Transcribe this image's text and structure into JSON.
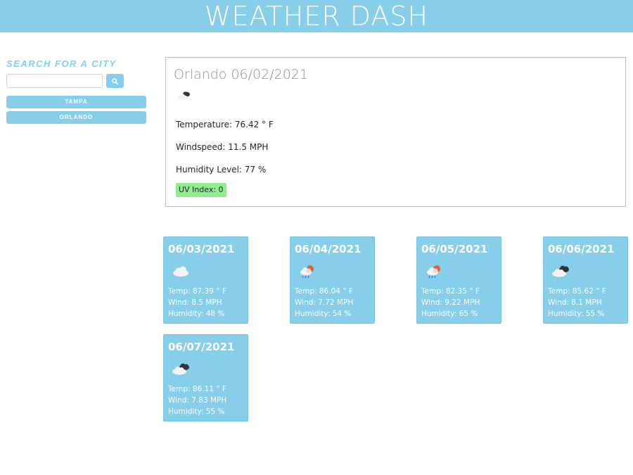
{
  "app": {
    "title": "WEATHER DASH"
  },
  "search": {
    "title": "SEARCH FOR A CITY",
    "input_value": "",
    "button_icon": "search-icon"
  },
  "history": [
    "TAMPA",
    "ORLANDO"
  ],
  "current": {
    "heading": "Orlando 06/02/2021",
    "icon": "cloudy-icon",
    "temperature": "Temperature: 76.42 ° F",
    "wind": "Windspeed: 11.5 MPH",
    "humidity": "Humidity Level: 77 %",
    "uv": "UV Index: 0",
    "uv_color": "#90ee90"
  },
  "forecast": [
    {
      "date": "06/03/2021",
      "icon": "cloud-icon",
      "temp": "Temp: 87.39 ° F",
      "wind": "Wind: 8.5 MPH",
      "humidity": "Humidity: 48 %"
    },
    {
      "date": "06/04/2021",
      "icon": "rain-sun-icon",
      "temp": "Temp: 86.04 ° F",
      "wind": "Wind: 7.72 MPH",
      "humidity": "Humidity: 54 %"
    },
    {
      "date": "06/05/2021",
      "icon": "rain-sun-icon",
      "temp": "Temp: 82.35 ° F",
      "wind": "Wind: 9.22 MPH",
      "humidity": "Humidity: 65 %"
    },
    {
      "date": "06/06/2021",
      "icon": "broken-clouds-icon",
      "temp": "Temp: 85.62 ° F",
      "wind": "Wind: 8.1 MPH",
      "humidity": "Humidity: 55 %"
    },
    {
      "date": "06/07/2021",
      "icon": "broken-clouds-icon",
      "temp": "Temp: 86.11 ° F",
      "wind": "Wind: 7.83 MPH",
      "humidity": "Humidity: 55 %"
    }
  ],
  "colors": {
    "accent": "#87ceeb",
    "uv_low": "#90ee90"
  }
}
